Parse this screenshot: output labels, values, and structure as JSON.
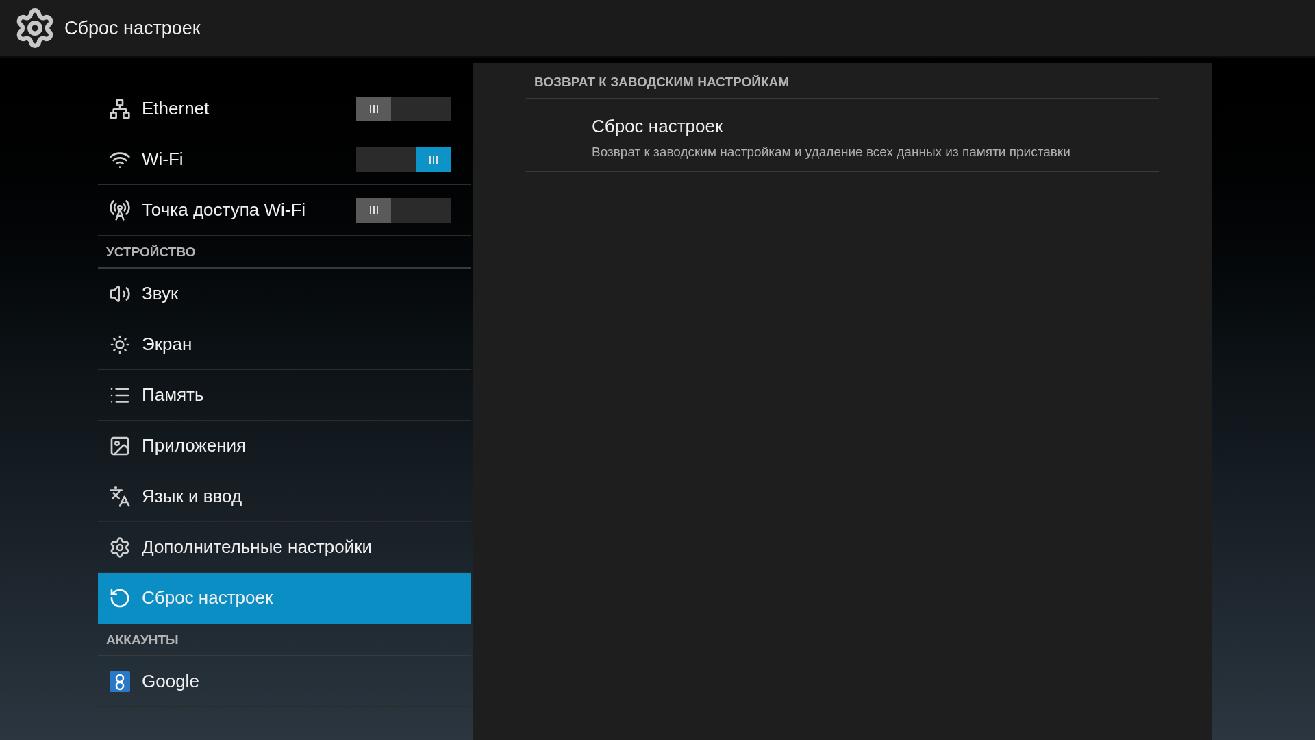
{
  "header": {
    "title": "Сброс настроек"
  },
  "sidebar": {
    "items": [
      {
        "kind": "toggle",
        "label": "Ethernet",
        "on": false
      },
      {
        "kind": "toggle",
        "label": "Wi-Fi",
        "on": true
      },
      {
        "kind": "toggle",
        "label": "Точка доступа Wi-Fi",
        "on": false
      },
      {
        "kind": "header",
        "label": "УСТРОЙСТВО"
      },
      {
        "kind": "item",
        "label": "Звук",
        "selected": false
      },
      {
        "kind": "item",
        "label": "Экран",
        "selected": false
      },
      {
        "kind": "item",
        "label": "Память",
        "selected": false
      },
      {
        "kind": "item",
        "label": "Приложения",
        "selected": false
      },
      {
        "kind": "item",
        "label": "Язык и ввод",
        "selected": false
      },
      {
        "kind": "item",
        "label": "Дополнительные настройки",
        "selected": false
      },
      {
        "kind": "item",
        "label": "Сброс настроек",
        "selected": true
      },
      {
        "kind": "header",
        "label": "АККАУНТЫ"
      },
      {
        "kind": "item",
        "label": "Google",
        "selected": false
      }
    ]
  },
  "detail": {
    "section": "ВОЗВРАТ К ЗАВОДСКИМ НАСТРОЙКАМ",
    "item": {
      "title": "Сброс настроек",
      "subtitle": "Возврат к заводским настройкам и удаление всех данных из памяти приставки"
    }
  }
}
